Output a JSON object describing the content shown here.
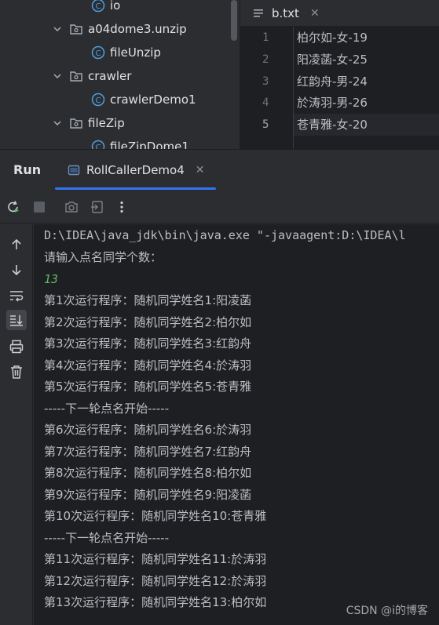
{
  "project_tree": [
    {
      "label": "io",
      "kind": "class",
      "expanded": null
    },
    {
      "label": "a04dome3.unzip",
      "kind": "package",
      "expanded": true
    },
    {
      "label": "fileUnzip",
      "kind": "class",
      "expanded": null
    },
    {
      "label": "crawler",
      "kind": "package",
      "expanded": true
    },
    {
      "label": "crawlerDemo1",
      "kind": "class",
      "expanded": null
    },
    {
      "label": "fileZip",
      "kind": "package",
      "expanded": true
    },
    {
      "label": "fileZipDome1",
      "kind": "class",
      "expanded": null
    }
  ],
  "editor": {
    "tab_label": "b.txt",
    "current_line": 5,
    "lines": [
      {
        "num": "1",
        "text": "柏尔如-女-19"
      },
      {
        "num": "2",
        "text": "阳凌菡-女-25"
      },
      {
        "num": "3",
        "text": "红韵舟-男-24"
      },
      {
        "num": "4",
        "text": "於涛羽-男-26"
      },
      {
        "num": "5",
        "text": "苍青雅-女-20"
      }
    ]
  },
  "run": {
    "title": "Run",
    "tab_label": "RollCallerDemo4"
  },
  "console": {
    "lines": [
      {
        "text": "D:\\IDEA\\java_jdk\\bin\\java.exe \"-javaagent:D:\\IDEA\\l",
        "style": "mono"
      },
      {
        "text": "请输入点名同学个数：",
        "style": "normal"
      },
      {
        "text": "13",
        "style": "input"
      },
      {
        "text": "第1次运行程序：随机同学姓名1:阳凌菡",
        "style": "normal"
      },
      {
        "text": "第2次运行程序：随机同学姓名2:柏尔如",
        "style": "normal"
      },
      {
        "text": "第3次运行程序：随机同学姓名3:红韵舟",
        "style": "normal"
      },
      {
        "text": "第4次运行程序：随机同学姓名4:於涛羽",
        "style": "normal"
      },
      {
        "text": "第5次运行程序：随机同学姓名5:苍青雅",
        "style": "normal"
      },
      {
        "text": "-----下一轮点名开始-----",
        "style": "normal"
      },
      {
        "text": "第6次运行程序：随机同学姓名6:於涛羽",
        "style": "normal"
      },
      {
        "text": "第7次运行程序：随机同学姓名7:红韵舟",
        "style": "normal"
      },
      {
        "text": "第8次运行程序：随机同学姓名8:柏尔如",
        "style": "normal"
      },
      {
        "text": "第9次运行程序：随机同学姓名9:阳凌菡",
        "style": "normal"
      },
      {
        "text": "第10次运行程序：随机同学姓名10:苍青雅",
        "style": "normal"
      },
      {
        "text": "-----下一轮点名开始-----",
        "style": "normal"
      },
      {
        "text": "第11次运行程序：随机同学姓名11:於涛羽",
        "style": "normal"
      },
      {
        "text": "第12次运行程序：随机同学姓名12:於涛羽",
        "style": "normal"
      },
      {
        "text": "第13次运行程序：随机同学姓名13:柏尔如",
        "style": "normal"
      }
    ]
  },
  "watermark": "CSDN @i的博客",
  "colors": {
    "background": "#2b2d30",
    "editor_bg": "#1e1f22",
    "accent": "#3574f0",
    "input_text": "#5fb865",
    "class_icon": "#4e9ee0"
  }
}
